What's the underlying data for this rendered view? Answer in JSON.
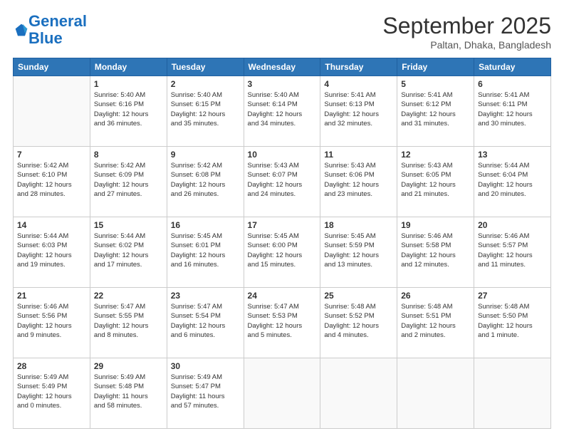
{
  "header": {
    "logo_line1": "General",
    "logo_line2": "Blue",
    "month": "September 2025",
    "location": "Paltan, Dhaka, Bangladesh"
  },
  "weekdays": [
    "Sunday",
    "Monday",
    "Tuesday",
    "Wednesday",
    "Thursday",
    "Friday",
    "Saturday"
  ],
  "weeks": [
    [
      {
        "day": "",
        "lines": []
      },
      {
        "day": "1",
        "lines": [
          "Sunrise: 5:40 AM",
          "Sunset: 6:16 PM",
          "Daylight: 12 hours",
          "and 36 minutes."
        ]
      },
      {
        "day": "2",
        "lines": [
          "Sunrise: 5:40 AM",
          "Sunset: 6:15 PM",
          "Daylight: 12 hours",
          "and 35 minutes."
        ]
      },
      {
        "day": "3",
        "lines": [
          "Sunrise: 5:40 AM",
          "Sunset: 6:14 PM",
          "Daylight: 12 hours",
          "and 34 minutes."
        ]
      },
      {
        "day": "4",
        "lines": [
          "Sunrise: 5:41 AM",
          "Sunset: 6:13 PM",
          "Daylight: 12 hours",
          "and 32 minutes."
        ]
      },
      {
        "day": "5",
        "lines": [
          "Sunrise: 5:41 AM",
          "Sunset: 6:12 PM",
          "Daylight: 12 hours",
          "and 31 minutes."
        ]
      },
      {
        "day": "6",
        "lines": [
          "Sunrise: 5:41 AM",
          "Sunset: 6:11 PM",
          "Daylight: 12 hours",
          "and 30 minutes."
        ]
      }
    ],
    [
      {
        "day": "7",
        "lines": [
          "Sunrise: 5:42 AM",
          "Sunset: 6:10 PM",
          "Daylight: 12 hours",
          "and 28 minutes."
        ]
      },
      {
        "day": "8",
        "lines": [
          "Sunrise: 5:42 AM",
          "Sunset: 6:09 PM",
          "Daylight: 12 hours",
          "and 27 minutes."
        ]
      },
      {
        "day": "9",
        "lines": [
          "Sunrise: 5:42 AM",
          "Sunset: 6:08 PM",
          "Daylight: 12 hours",
          "and 26 minutes."
        ]
      },
      {
        "day": "10",
        "lines": [
          "Sunrise: 5:43 AM",
          "Sunset: 6:07 PM",
          "Daylight: 12 hours",
          "and 24 minutes."
        ]
      },
      {
        "day": "11",
        "lines": [
          "Sunrise: 5:43 AM",
          "Sunset: 6:06 PM",
          "Daylight: 12 hours",
          "and 23 minutes."
        ]
      },
      {
        "day": "12",
        "lines": [
          "Sunrise: 5:43 AM",
          "Sunset: 6:05 PM",
          "Daylight: 12 hours",
          "and 21 minutes."
        ]
      },
      {
        "day": "13",
        "lines": [
          "Sunrise: 5:44 AM",
          "Sunset: 6:04 PM",
          "Daylight: 12 hours",
          "and 20 minutes."
        ]
      }
    ],
    [
      {
        "day": "14",
        "lines": [
          "Sunrise: 5:44 AM",
          "Sunset: 6:03 PM",
          "Daylight: 12 hours",
          "and 19 minutes."
        ]
      },
      {
        "day": "15",
        "lines": [
          "Sunrise: 5:44 AM",
          "Sunset: 6:02 PM",
          "Daylight: 12 hours",
          "and 17 minutes."
        ]
      },
      {
        "day": "16",
        "lines": [
          "Sunrise: 5:45 AM",
          "Sunset: 6:01 PM",
          "Daylight: 12 hours",
          "and 16 minutes."
        ]
      },
      {
        "day": "17",
        "lines": [
          "Sunrise: 5:45 AM",
          "Sunset: 6:00 PM",
          "Daylight: 12 hours",
          "and 15 minutes."
        ]
      },
      {
        "day": "18",
        "lines": [
          "Sunrise: 5:45 AM",
          "Sunset: 5:59 PM",
          "Daylight: 12 hours",
          "and 13 minutes."
        ]
      },
      {
        "day": "19",
        "lines": [
          "Sunrise: 5:46 AM",
          "Sunset: 5:58 PM",
          "Daylight: 12 hours",
          "and 12 minutes."
        ]
      },
      {
        "day": "20",
        "lines": [
          "Sunrise: 5:46 AM",
          "Sunset: 5:57 PM",
          "Daylight: 12 hours",
          "and 11 minutes."
        ]
      }
    ],
    [
      {
        "day": "21",
        "lines": [
          "Sunrise: 5:46 AM",
          "Sunset: 5:56 PM",
          "Daylight: 12 hours",
          "and 9 minutes."
        ]
      },
      {
        "day": "22",
        "lines": [
          "Sunrise: 5:47 AM",
          "Sunset: 5:55 PM",
          "Daylight: 12 hours",
          "and 8 minutes."
        ]
      },
      {
        "day": "23",
        "lines": [
          "Sunrise: 5:47 AM",
          "Sunset: 5:54 PM",
          "Daylight: 12 hours",
          "and 6 minutes."
        ]
      },
      {
        "day": "24",
        "lines": [
          "Sunrise: 5:47 AM",
          "Sunset: 5:53 PM",
          "Daylight: 12 hours",
          "and 5 minutes."
        ]
      },
      {
        "day": "25",
        "lines": [
          "Sunrise: 5:48 AM",
          "Sunset: 5:52 PM",
          "Daylight: 12 hours",
          "and 4 minutes."
        ]
      },
      {
        "day": "26",
        "lines": [
          "Sunrise: 5:48 AM",
          "Sunset: 5:51 PM",
          "Daylight: 12 hours",
          "and 2 minutes."
        ]
      },
      {
        "day": "27",
        "lines": [
          "Sunrise: 5:48 AM",
          "Sunset: 5:50 PM",
          "Daylight: 12 hours",
          "and 1 minute."
        ]
      }
    ],
    [
      {
        "day": "28",
        "lines": [
          "Sunrise: 5:49 AM",
          "Sunset: 5:49 PM",
          "Daylight: 12 hours",
          "and 0 minutes."
        ]
      },
      {
        "day": "29",
        "lines": [
          "Sunrise: 5:49 AM",
          "Sunset: 5:48 PM",
          "Daylight: 11 hours",
          "and 58 minutes."
        ]
      },
      {
        "day": "30",
        "lines": [
          "Sunrise: 5:49 AM",
          "Sunset: 5:47 PM",
          "Daylight: 11 hours",
          "and 57 minutes."
        ]
      },
      {
        "day": "",
        "lines": []
      },
      {
        "day": "",
        "lines": []
      },
      {
        "day": "",
        "lines": []
      },
      {
        "day": "",
        "lines": []
      }
    ]
  ]
}
